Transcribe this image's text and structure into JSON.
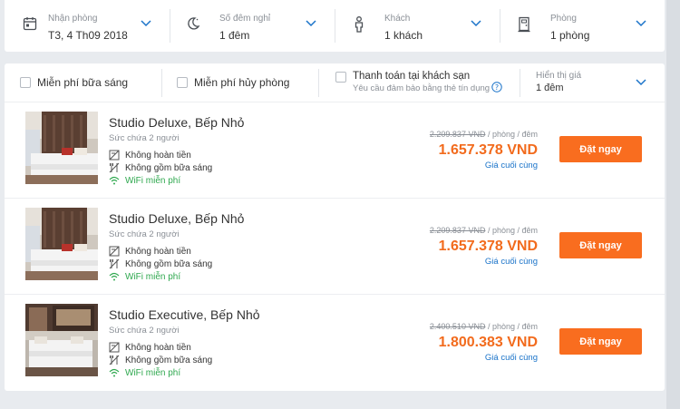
{
  "search": {
    "checkin": {
      "label": "Nhận phòng",
      "value": "T3, 4 Th09 2018",
      "icon": "calendar-icon"
    },
    "nights": {
      "label": "Số đêm nghỉ",
      "value": "1 đêm",
      "icon": "moon-icon"
    },
    "guests": {
      "label": "Khách",
      "value": "1 khách",
      "icon": "person-icon"
    },
    "rooms": {
      "label": "Phòng",
      "value": "1 phòng",
      "icon": "door-icon"
    }
  },
  "filters": {
    "breakfast": "Miễn phí bữa sáng",
    "free_cancel": "Miễn phí hủy phòng",
    "pay_at_hotel": "Thanh toán tại khách sạn",
    "pay_at_hotel_sub": "Yêu cầu đảm bảo bằng thẻ tín dụng",
    "price_display_label": "Hiển thị giá",
    "price_display_value": "1 đêm"
  },
  "rooms": [
    {
      "name": "Studio Deluxe, Bếp Nhỏ",
      "capacity": "Sức chứa 2 người",
      "features": [
        "Không hoàn tiền",
        "Không gồm bữa sáng",
        "WiFi miễn phí"
      ],
      "old_price": "2.209.837 VND",
      "per": " / phòng / đêm",
      "price": "1.657.378 VND",
      "final_label": "Giá cuối cùng",
      "book_label": "Đặt ngay"
    },
    {
      "name": "Studio Deluxe, Bếp Nhỏ",
      "capacity": "Sức chứa 2 người",
      "features": [
        "Không hoàn tiền",
        "Không gồm bữa sáng",
        "WiFi miễn phí"
      ],
      "old_price": "2.209.837 VND",
      "per": " / phòng / đêm",
      "price": "1.657.378 VND",
      "final_label": "Giá cuối cùng",
      "book_label": "Đặt ngay"
    },
    {
      "name": "Studio Executive, Bếp Nhỏ",
      "capacity": "Sức chứa 2 người",
      "features": [
        "Không hoàn tiền",
        "Không gồm bữa sáng",
        "WiFi miễn phí"
      ],
      "old_price": "2.400.510 VND",
      "per": " / phòng / đêm",
      "price": "1.800.383 VND",
      "final_label": "Giá cuối cùng",
      "book_label": "Đặt ngay"
    }
  ],
  "colors": {
    "accent": "#f96d1f",
    "price": "#f26b1d",
    "link": "#1a73c9",
    "wifi": "#2fa84f"
  }
}
